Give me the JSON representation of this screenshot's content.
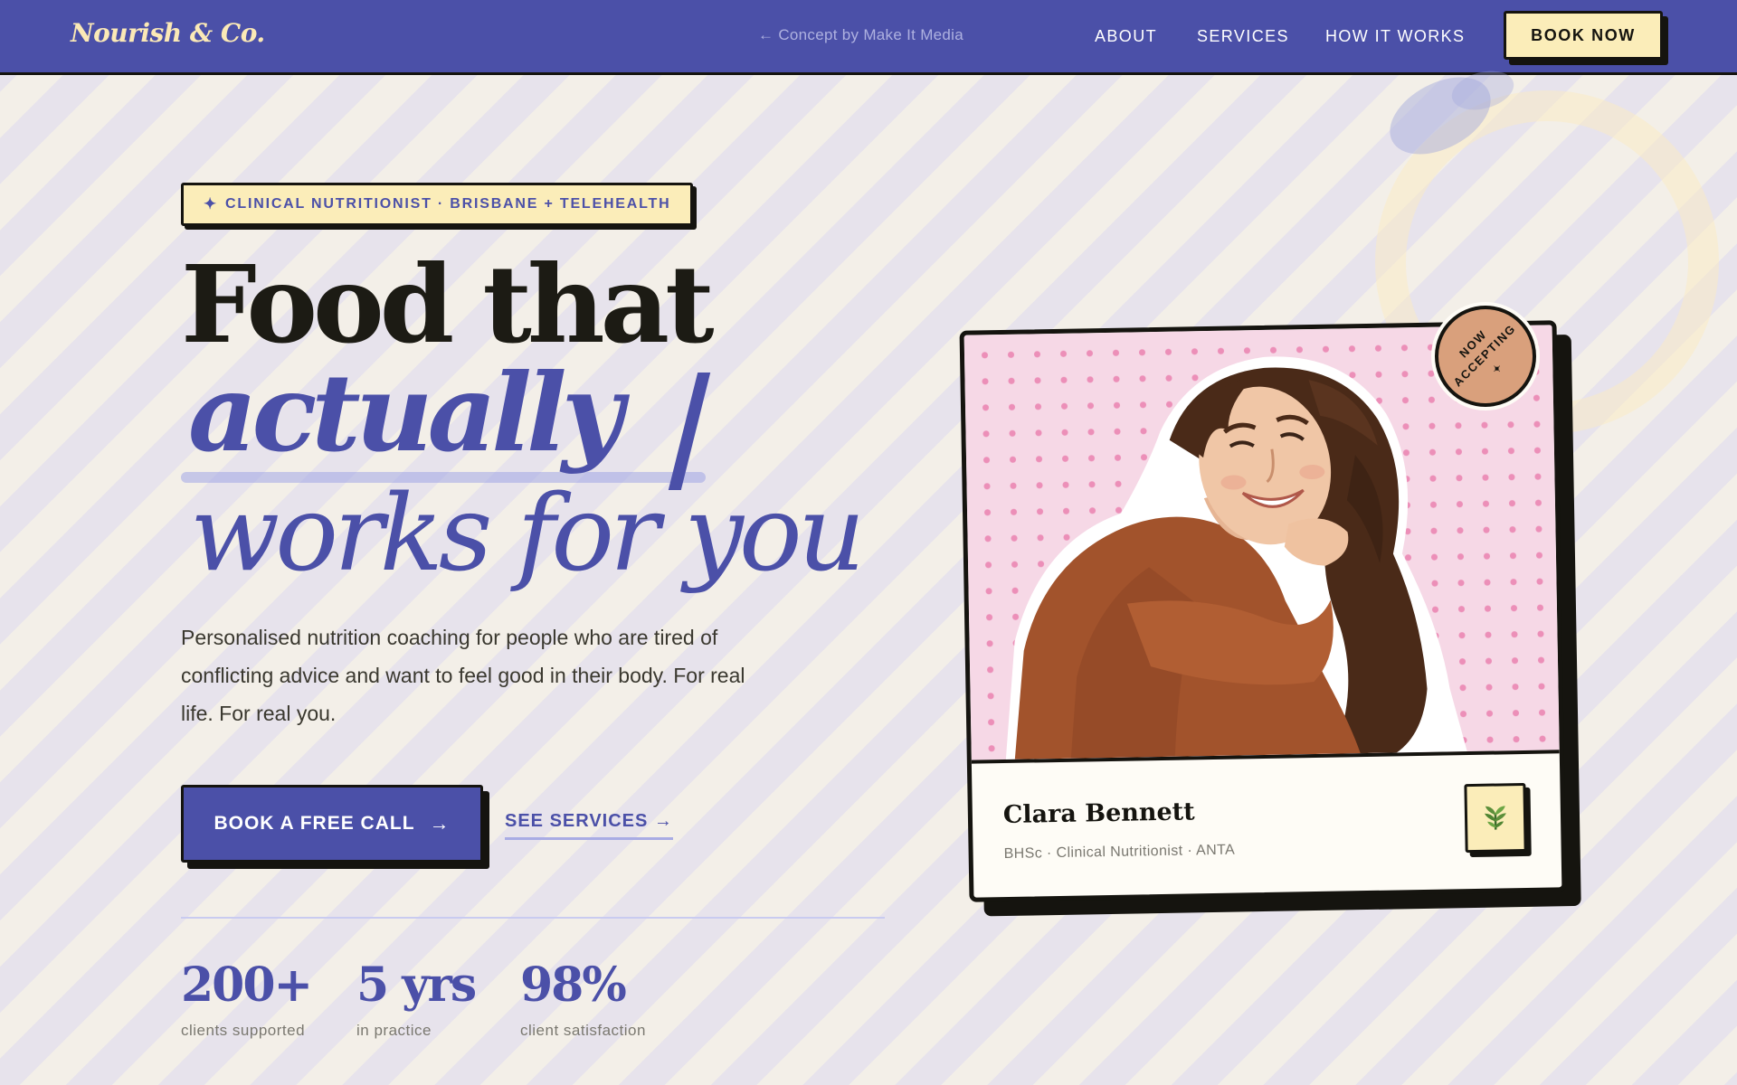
{
  "nav": {
    "brand": "Nourish & Co.",
    "credit": "← Concept by Make It Media",
    "links": [
      {
        "label": "ABOUT"
      },
      {
        "label": "SERVICES"
      },
      {
        "label": "HOW IT WORKS"
      }
    ],
    "cta_label": "BOOK NOW"
  },
  "hero": {
    "tag_star": "✦",
    "tag_label": "CLINICAL NUTRITIONIST · BRISBANE + TELEHEALTH",
    "headline_line1": "Food that",
    "headline_line2": "actually",
    "headline_line3": "works for you",
    "lede": "Personalised nutrition coaching for people who are tired of conflicting advice and want to feel good in their body. For real life. For real you.",
    "primary_cta": "BOOK A FREE CALL",
    "primary_cta_arrow": "→",
    "secondary_cta": "SEE SERVICES →",
    "stats": [
      {
        "value": "200+",
        "label": "clients supported"
      },
      {
        "value": "5 yrs",
        "label": "in practice"
      },
      {
        "value": "98%",
        "label": "client satisfaction"
      }
    ]
  },
  "profile": {
    "name": "Clara Bennett",
    "credentials": "BHSc · Clinical Nutritionist · ANTA",
    "badge_icon": "leaf-icon",
    "photo_icon": "portrait-photo",
    "stamp_line1": "NOW",
    "stamp_line2": "ACCEPTING",
    "stamp_star": "✦"
  },
  "colors": {
    "brand_indigo": "#4b50a8",
    "cream": "#fbedb9",
    "ink": "#15140f",
    "pink": "#f6d8e6",
    "stamp": "#d9a07c"
  }
}
